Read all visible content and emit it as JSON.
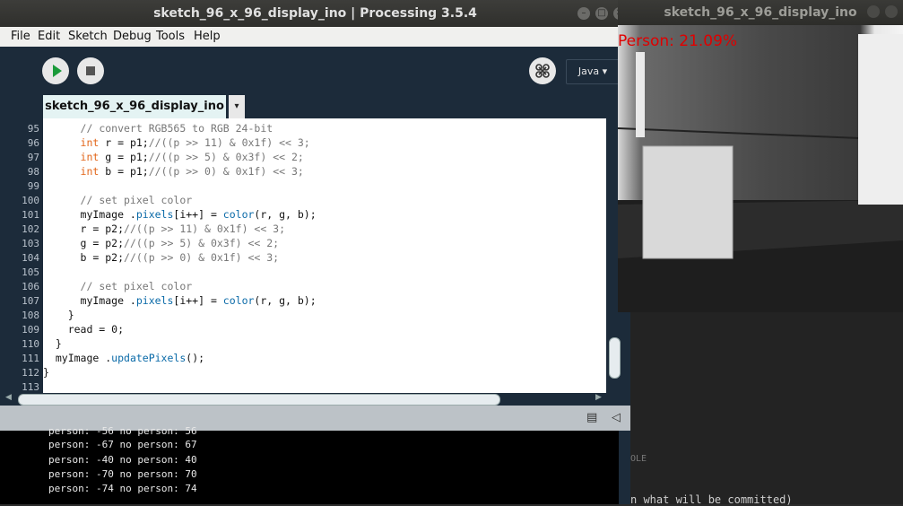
{
  "processing_window": {
    "title": "sketch_96_x_96_display_ino | Processing 3.5.4",
    "menu": [
      "File",
      "Edit",
      "Sketch",
      "Debug",
      "Tools",
      "Help"
    ],
    "mode": "Java",
    "tab": "sketch_96_x_96_display_ino",
    "tab_menu_symbol": "▾",
    "minimize_symbol": "–",
    "maximize_symbol": "□",
    "close_symbol": "✕",
    "line_numbers": [
      "95",
      "96",
      "97",
      "98",
      "99",
      "100",
      "101",
      "102",
      "103",
      "104",
      "105",
      "106",
      "107",
      "108",
      "109",
      "110",
      "111",
      "112",
      "113"
    ],
    "code_lines": [
      "      // convert RGB565 to RGB 24-bit",
      "      int r = p1;//((p >> 11) & 0x1f) << 3;",
      "      int g = p1;//((p >> 5) & 0x3f) << 2;",
      "      int b = p1;//((p >> 0) & 0x1f) << 3;",
      "",
      "      // set pixel color",
      "      myImage .pixels[i++] = color(r, g, b);",
      "      r = p2;//((p >> 11) & 0x1f) << 3;",
      "      g = p2;//((p >> 5) & 0x3f) << 2;",
      "      b = p2;//((p >> 0) & 0x1f) << 3;",
      "",
      "      // set pixel color",
      "      myImage .pixels[i++] = color(r, g, b);",
      "    }",
      "    read = 0;",
      "  }",
      "  myImage .updatePixels();",
      "}",
      ""
    ],
    "console_lines": [
      "person: -56 no person: 56",
      "person: -67 no person: 67",
      "person: -40 no person: 40",
      "person: -70 no person: 70",
      "person: -74 no person: 74"
    ]
  },
  "camera_window": {
    "title": "sketch_96_x_96_display_ino",
    "label": "Person: 21.09%"
  },
  "background": {
    "fragment_1": "OLE",
    "fragment_2": "n what will be committed)"
  },
  "colors": {
    "editor_bg": "#1c2b3a",
    "keyword": "#e2661a",
    "function": "#0a6aa8",
    "comment": "#777777",
    "label_red": "#e00000"
  }
}
